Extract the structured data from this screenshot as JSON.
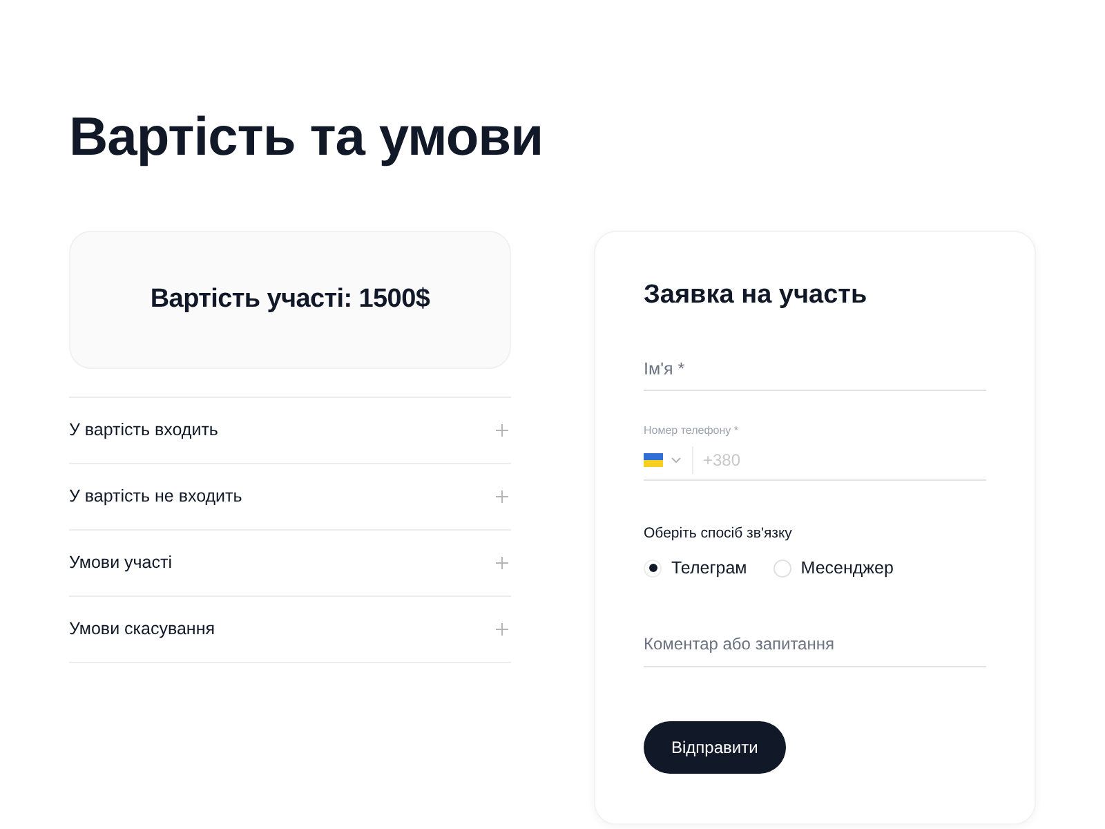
{
  "heading": "Вартість та умови",
  "price_card": {
    "text": "Вартість участі: 1500$"
  },
  "accordion": [
    {
      "title": "У вартість входить",
      "expanded": false
    },
    {
      "title": "У вартість не входить",
      "expanded": false
    },
    {
      "title": "Умови участі",
      "expanded": false
    },
    {
      "title": "Умови скасування",
      "expanded": false
    }
  ],
  "form": {
    "title": "Заявка на участь",
    "name_field": {
      "placeholder": "Ім'я *"
    },
    "phone_field": {
      "label": "Номер телефону *",
      "placeholder": "+380"
    },
    "contact_method": {
      "label": "Оберіть спосіб зв'язку",
      "options": [
        {
          "label": "Телеграм",
          "selected": true
        },
        {
          "label": "Месенджер",
          "selected": false
        }
      ]
    },
    "comment_field": {
      "placeholder": "Коментар або запитання"
    },
    "submit_button": "Відправити"
  }
}
